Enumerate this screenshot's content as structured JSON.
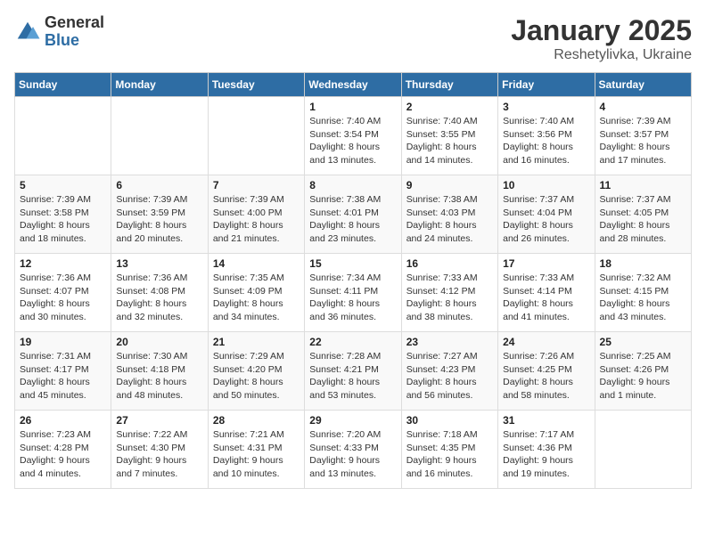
{
  "logo": {
    "general": "General",
    "blue": "Blue"
  },
  "title": "January 2025",
  "location": "Reshetylivka, Ukraine",
  "days_of_week": [
    "Sunday",
    "Monday",
    "Tuesday",
    "Wednesday",
    "Thursday",
    "Friday",
    "Saturday"
  ],
  "weeks": [
    [
      {
        "day": "",
        "info": ""
      },
      {
        "day": "",
        "info": ""
      },
      {
        "day": "",
        "info": ""
      },
      {
        "day": "1",
        "info": "Sunrise: 7:40 AM\nSunset: 3:54 PM\nDaylight: 8 hours and 13 minutes."
      },
      {
        "day": "2",
        "info": "Sunrise: 7:40 AM\nSunset: 3:55 PM\nDaylight: 8 hours and 14 minutes."
      },
      {
        "day": "3",
        "info": "Sunrise: 7:40 AM\nSunset: 3:56 PM\nDaylight: 8 hours and 16 minutes."
      },
      {
        "day": "4",
        "info": "Sunrise: 7:39 AM\nSunset: 3:57 PM\nDaylight: 8 hours and 17 minutes."
      }
    ],
    [
      {
        "day": "5",
        "info": "Sunrise: 7:39 AM\nSunset: 3:58 PM\nDaylight: 8 hours and 18 minutes."
      },
      {
        "day": "6",
        "info": "Sunrise: 7:39 AM\nSunset: 3:59 PM\nDaylight: 8 hours and 20 minutes."
      },
      {
        "day": "7",
        "info": "Sunrise: 7:39 AM\nSunset: 4:00 PM\nDaylight: 8 hours and 21 minutes."
      },
      {
        "day": "8",
        "info": "Sunrise: 7:38 AM\nSunset: 4:01 PM\nDaylight: 8 hours and 23 minutes."
      },
      {
        "day": "9",
        "info": "Sunrise: 7:38 AM\nSunset: 4:03 PM\nDaylight: 8 hours and 24 minutes."
      },
      {
        "day": "10",
        "info": "Sunrise: 7:37 AM\nSunset: 4:04 PM\nDaylight: 8 hours and 26 minutes."
      },
      {
        "day": "11",
        "info": "Sunrise: 7:37 AM\nSunset: 4:05 PM\nDaylight: 8 hours and 28 minutes."
      }
    ],
    [
      {
        "day": "12",
        "info": "Sunrise: 7:36 AM\nSunset: 4:07 PM\nDaylight: 8 hours and 30 minutes."
      },
      {
        "day": "13",
        "info": "Sunrise: 7:36 AM\nSunset: 4:08 PM\nDaylight: 8 hours and 32 minutes."
      },
      {
        "day": "14",
        "info": "Sunrise: 7:35 AM\nSunset: 4:09 PM\nDaylight: 8 hours and 34 minutes."
      },
      {
        "day": "15",
        "info": "Sunrise: 7:34 AM\nSunset: 4:11 PM\nDaylight: 8 hours and 36 minutes."
      },
      {
        "day": "16",
        "info": "Sunrise: 7:33 AM\nSunset: 4:12 PM\nDaylight: 8 hours and 38 minutes."
      },
      {
        "day": "17",
        "info": "Sunrise: 7:33 AM\nSunset: 4:14 PM\nDaylight: 8 hours and 41 minutes."
      },
      {
        "day": "18",
        "info": "Sunrise: 7:32 AM\nSunset: 4:15 PM\nDaylight: 8 hours and 43 minutes."
      }
    ],
    [
      {
        "day": "19",
        "info": "Sunrise: 7:31 AM\nSunset: 4:17 PM\nDaylight: 8 hours and 45 minutes."
      },
      {
        "day": "20",
        "info": "Sunrise: 7:30 AM\nSunset: 4:18 PM\nDaylight: 8 hours and 48 minutes."
      },
      {
        "day": "21",
        "info": "Sunrise: 7:29 AM\nSunset: 4:20 PM\nDaylight: 8 hours and 50 minutes."
      },
      {
        "day": "22",
        "info": "Sunrise: 7:28 AM\nSunset: 4:21 PM\nDaylight: 8 hours and 53 minutes."
      },
      {
        "day": "23",
        "info": "Sunrise: 7:27 AM\nSunset: 4:23 PM\nDaylight: 8 hours and 56 minutes."
      },
      {
        "day": "24",
        "info": "Sunrise: 7:26 AM\nSunset: 4:25 PM\nDaylight: 8 hours and 58 minutes."
      },
      {
        "day": "25",
        "info": "Sunrise: 7:25 AM\nSunset: 4:26 PM\nDaylight: 9 hours and 1 minute."
      }
    ],
    [
      {
        "day": "26",
        "info": "Sunrise: 7:23 AM\nSunset: 4:28 PM\nDaylight: 9 hours and 4 minutes."
      },
      {
        "day": "27",
        "info": "Sunrise: 7:22 AM\nSunset: 4:30 PM\nDaylight: 9 hours and 7 minutes."
      },
      {
        "day": "28",
        "info": "Sunrise: 7:21 AM\nSunset: 4:31 PM\nDaylight: 9 hours and 10 minutes."
      },
      {
        "day": "29",
        "info": "Sunrise: 7:20 AM\nSunset: 4:33 PM\nDaylight: 9 hours and 13 minutes."
      },
      {
        "day": "30",
        "info": "Sunrise: 7:18 AM\nSunset: 4:35 PM\nDaylight: 9 hours and 16 minutes."
      },
      {
        "day": "31",
        "info": "Sunrise: 7:17 AM\nSunset: 4:36 PM\nDaylight: 9 hours and 19 minutes."
      },
      {
        "day": "",
        "info": ""
      }
    ]
  ]
}
